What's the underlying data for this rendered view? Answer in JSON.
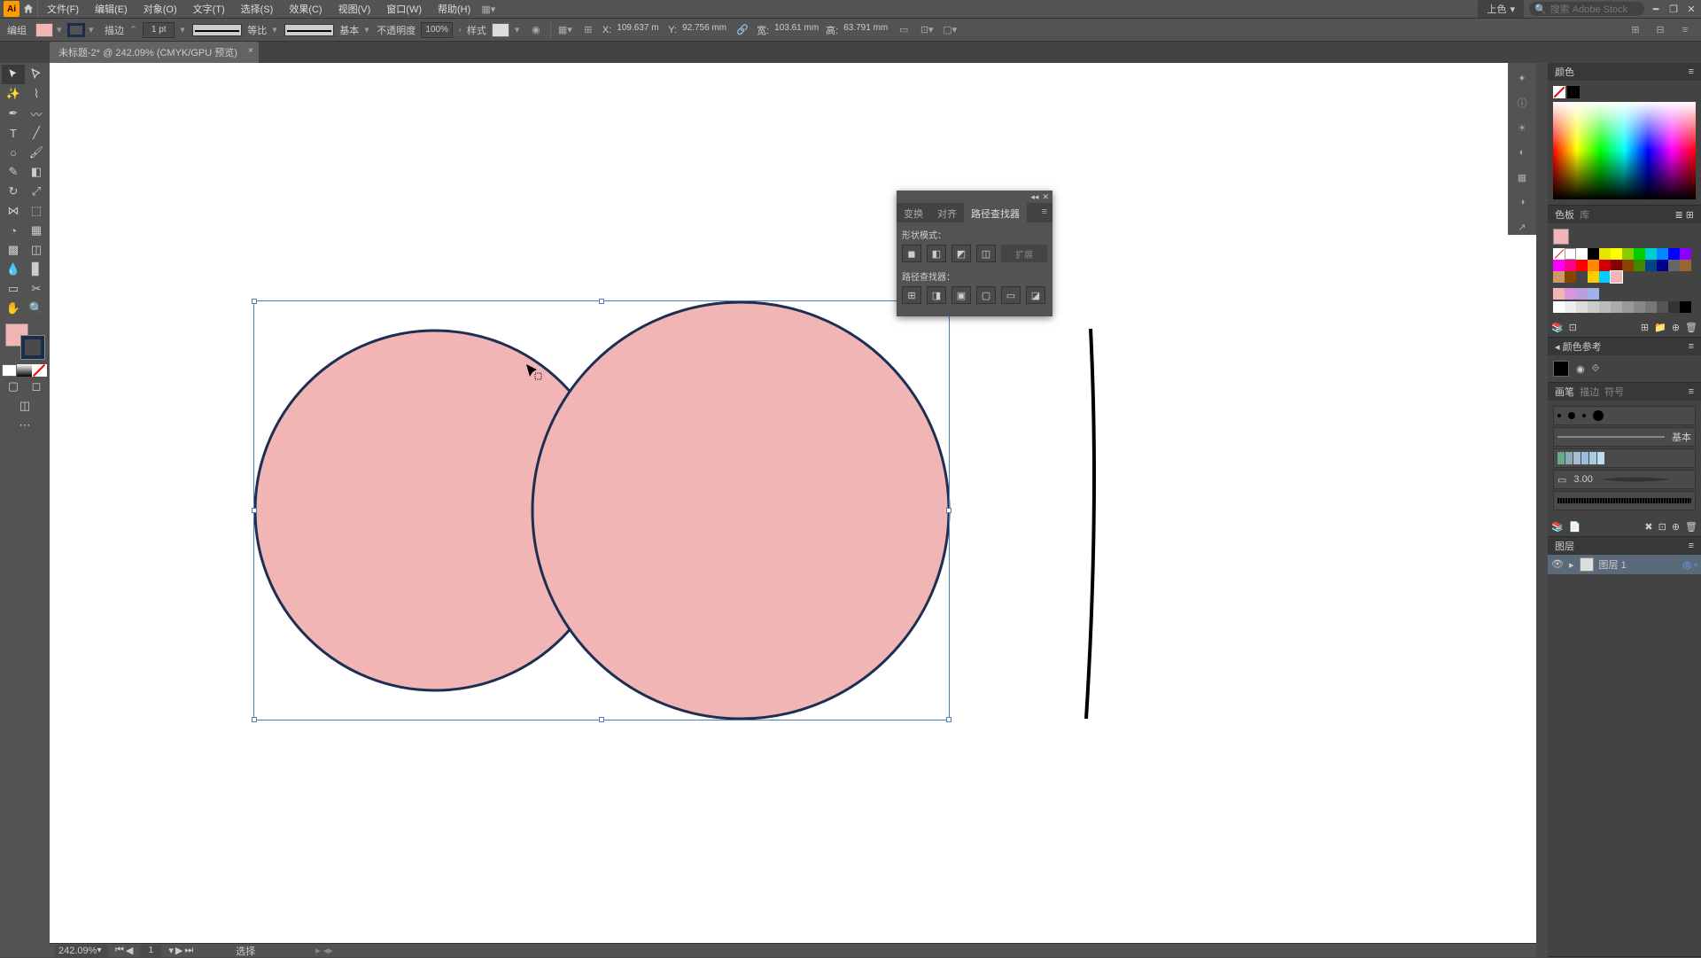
{
  "menubar": {
    "logo": "Ai",
    "items": [
      "文件(F)",
      "编辑(E)",
      "对象(O)",
      "文字(T)",
      "选择(S)",
      "效果(C)",
      "视图(V)",
      "窗口(W)",
      "帮助(H)"
    ],
    "layout_label": "上色",
    "search_placeholder": "搜索 Adobe Stock"
  },
  "controlbar": {
    "mode": "编组",
    "stroke_label": "描边",
    "stroke_value": "1 pt",
    "profile_label": "等比",
    "brush_label": "基本",
    "opacity_label": "不透明度",
    "opacity_value": "100%",
    "style_label": "样式",
    "x_label": "X:",
    "x_value": "109.637 m",
    "y_label": "Y:",
    "y_value": "92.756 mm",
    "w_label": "宽:",
    "w_value": "103.61 mm",
    "h_label": "高:",
    "h_value": "63.791 mm"
  },
  "document": {
    "tab_title": "未标题-2* @ 242.09% (CMYK/GPU 预览)"
  },
  "pathfinder": {
    "tab_transform": "变换",
    "tab_align": "对齐",
    "tab_pathfinder": "路径查找器",
    "shape_modes_label": "形状模式：",
    "pathfinders_label": "路径查找器：",
    "expand_label": "扩展"
  },
  "panels": {
    "color": "颜色",
    "swatches": "色板",
    "swatches_lib": "库",
    "color_guide": "颜色参考",
    "brushes": "画笔",
    "stroke": "描边",
    "symbols": "符号",
    "brush_basic": "基本",
    "brush_width": "3.00",
    "layers": "图层",
    "layer1": "图层 1"
  },
  "status": {
    "zoom": "242.09%",
    "artboard": "1",
    "tool": "选择"
  },
  "colors": {
    "fill": "#f2b5b5",
    "stroke": "#1a2d4a",
    "circle_stroke": "#1c2f52"
  }
}
